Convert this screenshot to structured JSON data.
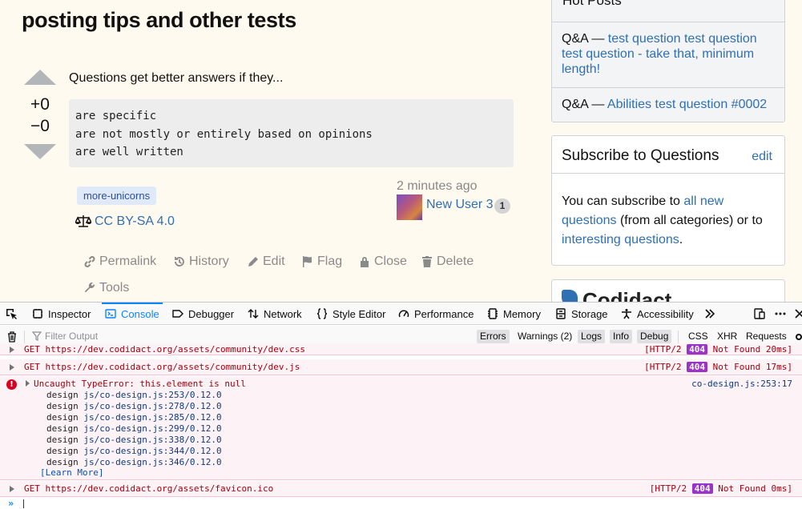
{
  "post": {
    "title": "posting tips and other tests",
    "score_up": "+0",
    "score_down": "−0",
    "intro": "Questions get better answers if they...",
    "code_lines": [
      "are specific",
      "are not mostly or entirely based on opinions",
      "are well written"
    ],
    "tag": "more-unicorns",
    "license": "CC BY-SA 4.0",
    "time": "2 minutes ago",
    "author": "New User 3",
    "author_rep": "1",
    "actions": {
      "permalink": "Permalink",
      "history": "History",
      "edit": "Edit",
      "flag": "Flag",
      "close": "Close",
      "delete": "Delete",
      "tools": "Tools"
    }
  },
  "sidebar": {
    "hot_title": "Hot Posts",
    "hot_items": [
      {
        "prefix": "Q&A — ",
        "link": "test question test question test question - take that, minimum length!"
      },
      {
        "prefix": "Q&A — ",
        "link": "Abilities test question #0002"
      }
    ],
    "subscribe_title": "Subscribe to Questions",
    "subscribe_edit": "edit",
    "subscribe_text_1": "You can subscribe to ",
    "subscribe_link_1": "all new questions",
    "subscribe_text_2": " (from all categories) or to ",
    "subscribe_link_2": "interesting questions",
    "subscribe_text_3": ".",
    "brand": "Codidact"
  },
  "devtools": {
    "tabs": {
      "inspector": "Inspector",
      "console": "Console",
      "debugger": "Debugger",
      "network": "Network",
      "style_editor": "Style Editor",
      "performance": "Performance",
      "memory": "Memory",
      "storage": "Storage",
      "accessibility": "Accessibility"
    },
    "filter_placeholder": "Filter Output",
    "filters": {
      "errors": "Errors",
      "warnings": "Warnings (2)",
      "logs": "Logs",
      "info": "Info",
      "debug": "Debug",
      "css": "CSS",
      "xhr": "XHR",
      "requests": "Requests"
    },
    "rows": [
      {
        "msg": "GET https://dev.codidact.org/assets/community/dev.css",
        "meta_pre": "[HTTP/2 ",
        "badge": "404",
        "meta_post": " Not Found 20ms]"
      },
      {
        "msg": "GET https://dev.codidact.org/assets/community/dev.js",
        "meta_pre": "[HTTP/2 ",
        "badge": "404",
        "meta_post": " Not Found 17ms]"
      }
    ],
    "error": {
      "message": "Uncaught TypeError: this.element is null",
      "source": "co-design.js:253:17",
      "stack": [
        {
          "fn": "design",
          "loc": "js/co-design.js:253/0.12.0"
        },
        {
          "fn": "design",
          "loc": "js/co-design.js:278/0.12.0"
        },
        {
          "fn": "design",
          "loc": "js/co-design.js:285/0.12.0"
        },
        {
          "fn": "design",
          "loc": "js/co-design.js:299/0.12.0"
        },
        {
          "fn": "design",
          "loc": "js/co-design.js:338/0.12.0"
        },
        {
          "fn": "design",
          "loc": "js/co-design.js:344/0.12.0"
        },
        {
          "fn": "design",
          "loc": "js/co-design.js:346/0.12.0"
        }
      ],
      "learn_more": "[Learn More]"
    },
    "favicon_row": {
      "msg": "GET https://dev.codidact.org/assets/favicon.ico",
      "meta_pre": "[HTTP/2 ",
      "badge": "404",
      "meta_post": " Not Found 0ms]"
    },
    "prompt": "»"
  },
  "icons": [
    "pick-element-icon",
    "inspector-icon",
    "console-icon",
    "debugger-icon",
    "network-icon",
    "style-editor-icon",
    "performance-icon",
    "memory-icon",
    "storage-icon",
    "accessibility-icon",
    "more-tools-icon",
    "responsive-icon",
    "menu-icon",
    "trash-icon",
    "filter-icon",
    "settings-icon",
    "link-icon",
    "history-icon",
    "pencil-icon",
    "flag-icon",
    "lock-icon",
    "trash-can-icon",
    "wrench-icon",
    "scale-icon"
  ],
  "colors": {
    "page_bg": "#fffaef",
    "link": "#2f6fb3",
    "error_bg": "#fdf2f5",
    "error_text": "#a4000f",
    "badge_404": "#9b33c9",
    "devtools_accent": "#0a84ff"
  }
}
